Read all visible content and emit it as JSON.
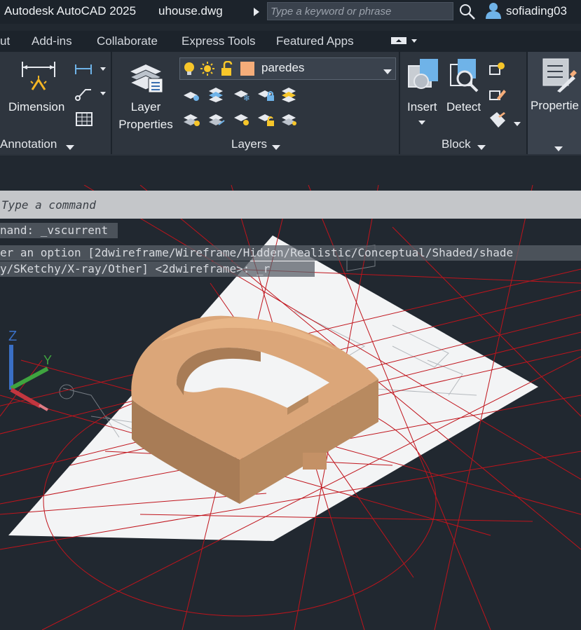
{
  "titlebar": {
    "app_name": "Autodesk AutoCAD 2025",
    "file_name": "uhouse.dwg",
    "search_placeholder": "Type a keyword or phrase",
    "username": "sofiading03"
  },
  "menu": {
    "items": [
      "ut",
      "Add-ins",
      "Collaborate",
      "Express Tools",
      "Featured Apps"
    ]
  },
  "ribbon": {
    "annotation": {
      "dimension_label": "Dimension",
      "panel_title": "Annotation"
    },
    "layers": {
      "layer_properties_line1": "Layer",
      "layer_properties_line2": "Properties",
      "current_layer": "paredes",
      "panel_title": "Layers"
    },
    "block": {
      "insert_label": "Insert",
      "detect_label": "Detect",
      "panel_title": "Block"
    },
    "properties": {
      "label": "Propertie"
    }
  },
  "command": {
    "placeholder": "Type a command",
    "history": [
      "nand: _vscurrent",
      "er an option [2dwireframe/Wireframe/Hidden/Realistic/Conceptual/Shaded/shade",
      "y/SKetchy/X-ray/Other] <2dwireframe>: _r"
    ]
  },
  "ucs": {
    "z_label": "Z",
    "y_label": "Y"
  },
  "colors": {
    "background": "#212830",
    "ribbon": "#2e353e",
    "construction_lines": "#c0141c",
    "model_fill": "#d9a578"
  }
}
